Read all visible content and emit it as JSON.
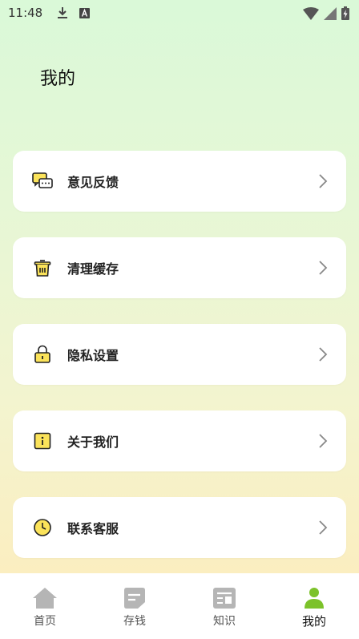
{
  "status_bar": {
    "time": "11:48"
  },
  "page": {
    "title": "我的"
  },
  "menu": {
    "items": [
      {
        "label": "意见反馈",
        "icon": "feedback-chat-icon"
      },
      {
        "label": "清理缓存",
        "icon": "trash-icon"
      },
      {
        "label": "隐私设置",
        "icon": "lock-icon"
      },
      {
        "label": "关于我们",
        "icon": "info-icon"
      },
      {
        "label": "联系客服",
        "icon": "clock-service-icon"
      }
    ]
  },
  "tab_bar": {
    "tabs": [
      {
        "label": "首页",
        "icon": "home-icon",
        "active": false
      },
      {
        "label": "存钱",
        "icon": "note-icon",
        "active": false
      },
      {
        "label": "知识",
        "icon": "news-icon",
        "active": false
      },
      {
        "label": "我的",
        "icon": "person-icon",
        "active": true
      }
    ]
  },
  "colors": {
    "accent_yellow": "#fbe35a",
    "active_tab": "#7cc22a",
    "inactive_tab": "#b5b5b5"
  }
}
